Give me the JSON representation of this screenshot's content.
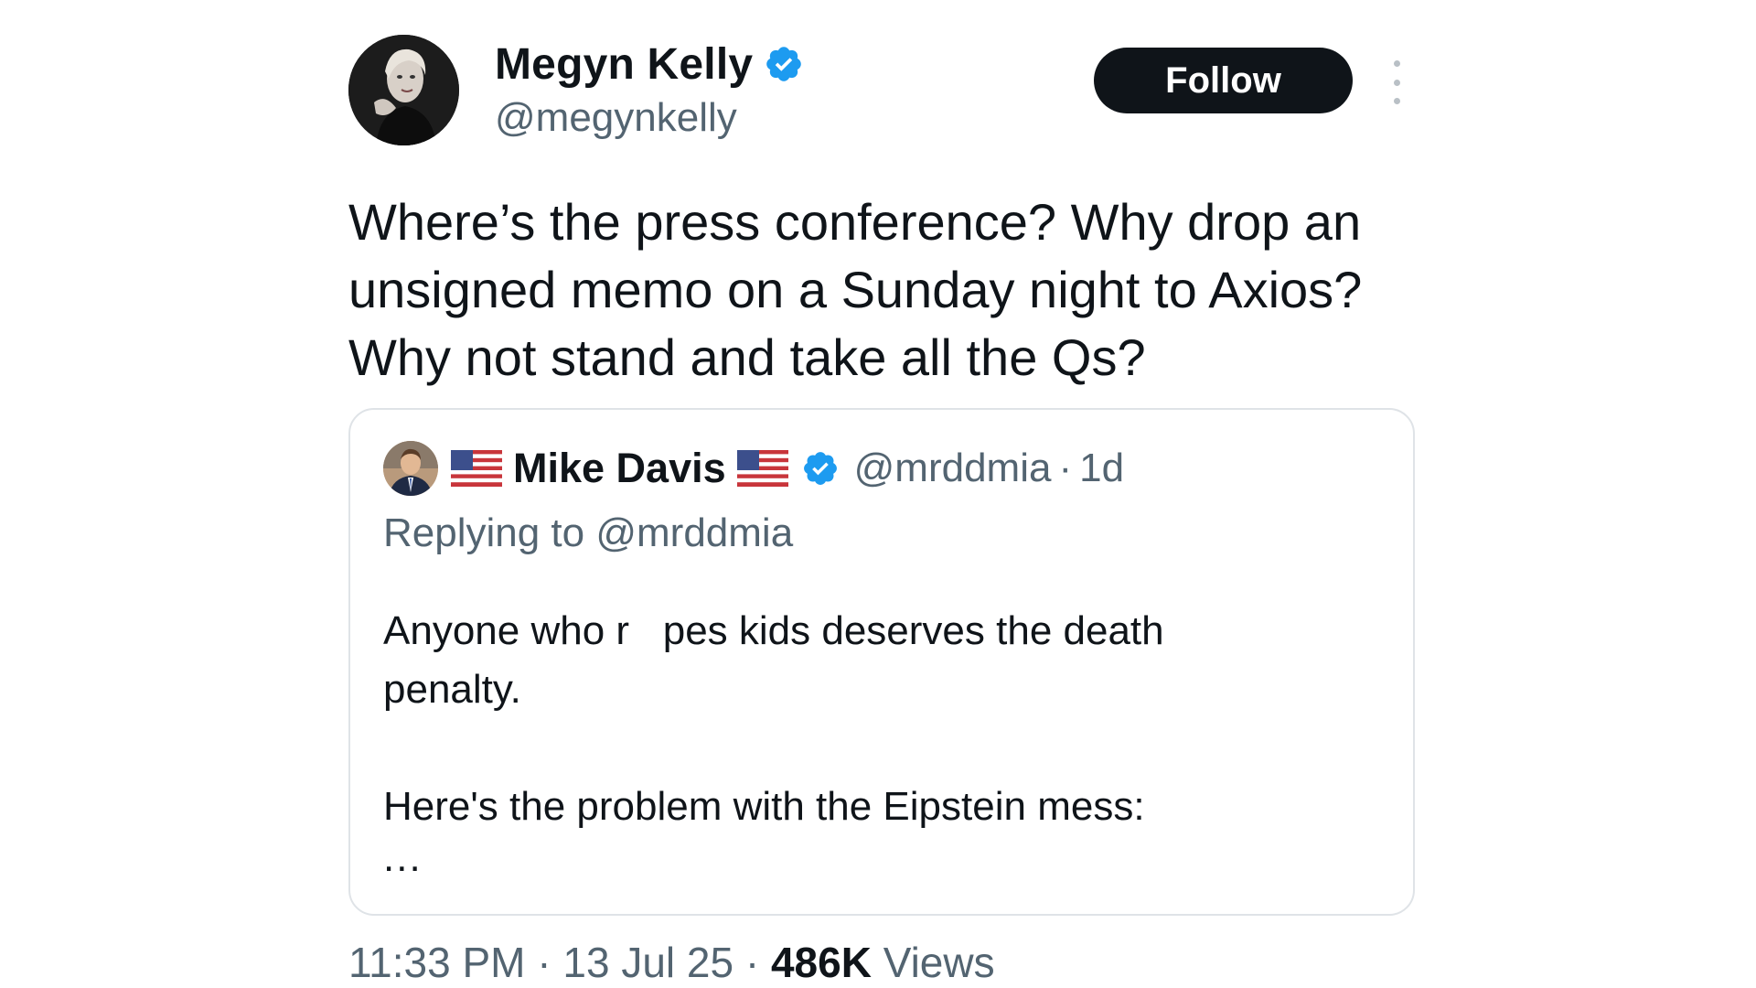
{
  "author": {
    "display_name": "Megyn Kelly",
    "handle": "@megynkelly",
    "verified": true
  },
  "follow_label": "Follow",
  "tweet_text": "Where’s the press conference? Why drop an unsigned memo on a Sunday night to Axios? Why not stand and take all the Qs?",
  "tweet_lines": [
    "Where’s the press conference? Why drop an",
    "unsigned memo on a Sunday night to Axios?",
    "Why not stand and take all the Qs?"
  ],
  "quote": {
    "display_name": "Mike Davis",
    "handle": "@mrddmia",
    "separator": "·",
    "time": "1d",
    "replying_to": "Replying to @mrddmia",
    "body_lines": [
      "Anyone who r   pes kids deserves the death",
      "penalty."
    ],
    "body_line_2": "Here's the problem with the Eipstein mess:",
    "ellipsis": "..."
  },
  "meta": {
    "time": "11:33 PM",
    "separator": "·",
    "date": "13 Jul 25",
    "views_count": "486K",
    "views_label": "Views"
  },
  "colors": {
    "text_primary": "#0f1419",
    "text_secondary": "#536471",
    "verified_blue": "#1d9bf0",
    "button_bg": "#0f1419",
    "border": "#dfe3e7"
  },
  "icons": {
    "verified": "verified-badge-icon",
    "more": "more-vertical-icon",
    "flag": "us-flag-icon"
  }
}
